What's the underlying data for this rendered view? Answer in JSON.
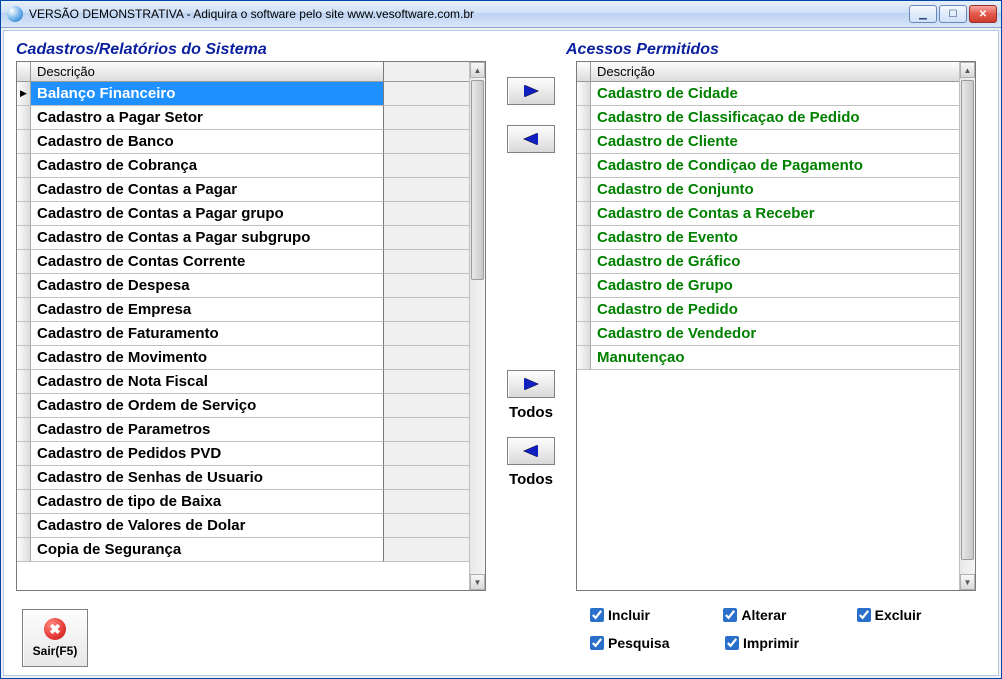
{
  "window": {
    "title": "VERSÃO DEMONSTRATIVA - Adiquira o software pelo site www.vesoftware.com.br"
  },
  "headings": {
    "left": "Cadastros/Relatórios do Sistema",
    "right": "Acessos Permitidos"
  },
  "column_header": "Descrição",
  "left_items": [
    "Balanço Financeiro",
    "Cadastro a Pagar Setor",
    "Cadastro de Banco",
    "Cadastro de Cobrança",
    "Cadastro de Contas a Pagar",
    "Cadastro de Contas a Pagar grupo",
    "Cadastro de Contas a Pagar subgrupo",
    "Cadastro de Contas Corrente",
    "Cadastro de Despesa",
    "Cadastro de Empresa",
    "Cadastro de Faturamento",
    "Cadastro de Movimento",
    "Cadastro de Nota Fiscal",
    "Cadastro de Ordem de Serviço",
    "Cadastro de Parametros",
    "Cadastro de Pedidos PVD",
    "Cadastro de Senhas de Usuario",
    "Cadastro de tipo de Baixa",
    "Cadastro de Valores de Dolar",
    "Copia de Segurança"
  ],
  "left_selected_index": 0,
  "right_items": [
    "Cadastro de Cidade",
    "Cadastro de Classificaçao de Pedido",
    "Cadastro de Cliente",
    "Cadastro de Condiçao de Pagamento",
    "Cadastro de Conjunto",
    "Cadastro de Contas a Receber",
    "Cadastro de Evento",
    "Cadastro de Gráfico",
    "Cadastro de Grupo",
    "Cadastro de Pedido",
    "Cadastro de Vendedor",
    "Manutençao"
  ],
  "buttons": {
    "todos": "Todos",
    "sair": "Sair(F5)"
  },
  "checks": {
    "incluir": {
      "label": "Incluir",
      "checked": true
    },
    "alterar": {
      "label": "Alterar",
      "checked": true
    },
    "excluir": {
      "label": "Excluir",
      "checked": true
    },
    "pesquisa": {
      "label": "Pesquisa",
      "checked": true
    },
    "imprimir": {
      "label": "Imprimir",
      "checked": true
    }
  }
}
